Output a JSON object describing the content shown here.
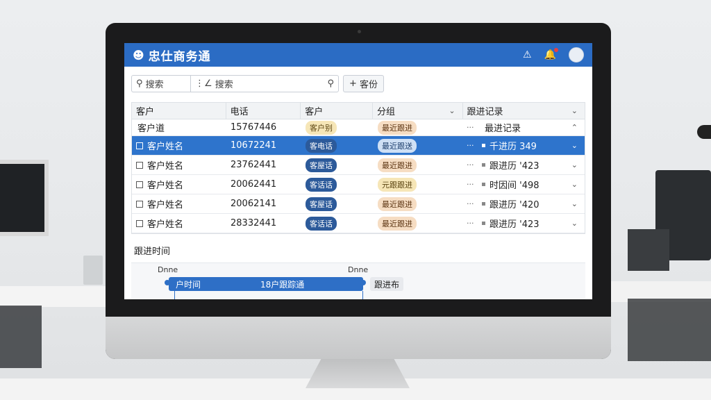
{
  "app": {
    "title": "忠仕商务通",
    "logo_icon": "person-icon"
  },
  "toolbar": {
    "search1_label": "搜索",
    "search2_label": "搜索",
    "add_button_label": "客份"
  },
  "table": {
    "headers": [
      "客户",
      "电话",
      "客户",
      "分组",
      "跟进记录"
    ],
    "rows": [
      {
        "name": "客户道",
        "phone": "15767446",
        "tag1": "客户别",
        "tag2": "最近跟进",
        "followup": "最进记录",
        "checkbox": false,
        "selected": false,
        "subheader": true
      },
      {
        "name": "客户姓名",
        "phone": "10672241",
        "tag1": "客电话",
        "tag2": "最近跟送",
        "followup": "千进历 349",
        "checkbox": true,
        "selected": true,
        "subheader": false
      },
      {
        "name": "客户姓名",
        "phone": "23762441",
        "tag1": "客屋话",
        "tag2": "最近跟进",
        "followup": "跟进历 '423",
        "checkbox": true,
        "selected": false,
        "subheader": false
      },
      {
        "name": "客户姓名",
        "phone": "20062441",
        "tag1": "客话话",
        "tag2": "元跟跟进",
        "followup": "时因间 '498",
        "checkbox": true,
        "selected": false,
        "subheader": false
      },
      {
        "name": "客户姓名",
        "phone": "20062141",
        "tag1": "客屋话",
        "tag2": "最近跟进",
        "followup": "跟进历 '420",
        "checkbox": true,
        "selected": false,
        "subheader": false
      },
      {
        "name": "客户姓名",
        "phone": "28332441",
        "tag1": "客话话",
        "tag2": "最近跟进",
        "followup": "跟进历 '423",
        "checkbox": true,
        "selected": false,
        "subheader": false
      }
    ]
  },
  "timeline": {
    "section_label": "跟进时间",
    "label_left": "Dnne",
    "label_right": "Dnne",
    "bar_left": "户时间",
    "bar_right": "18户跟踪通",
    "button_label": "跟进布"
  }
}
